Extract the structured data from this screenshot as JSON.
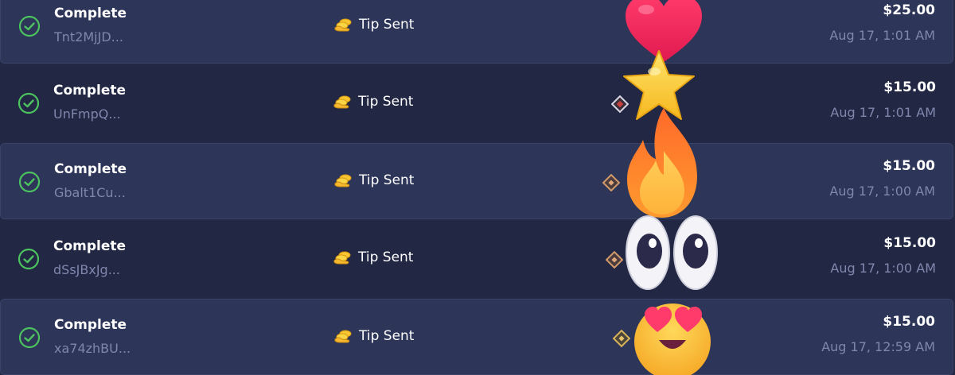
{
  "transactions": [
    {
      "status": "Complete",
      "id": "Tnt2MjJD...",
      "type": "Tip Sent",
      "amount": "$25.00",
      "date": "Aug 17, 1:01 AM"
    },
    {
      "status": "Complete",
      "id": "UnFmpQ...",
      "type": "Tip Sent",
      "amount": "$15.00",
      "date": "Aug 17, 1:01 AM"
    },
    {
      "status": "Complete",
      "id": "Gbalt1Cu...",
      "type": "Tip Sent",
      "amount": "$15.00",
      "date": "Aug 17, 1:00 AM"
    },
    {
      "status": "Complete",
      "id": "dSsJBxJg...",
      "type": "Tip Sent",
      "amount": "$15.00",
      "date": "Aug 17, 1:00 AM"
    },
    {
      "status": "Complete",
      "id": "xa74zhBU...",
      "type": "Tip Sent",
      "amount": "$15.00",
      "date": "Aug 17, 12:59 AM"
    }
  ],
  "icons": {
    "status": "check-circle-icon",
    "tip": "coins-hand-icon",
    "badge": "diamond-badge-icon",
    "reactions": [
      "heart-emoji",
      "star-emoji",
      "fire-emoji",
      "eyes-emoji",
      "heart-eyes-emoji"
    ]
  },
  "colors": {
    "success": "#4cc35f",
    "row_light": "#2d3558",
    "row_dark": "#222744",
    "muted_text": "#7f87ad"
  }
}
